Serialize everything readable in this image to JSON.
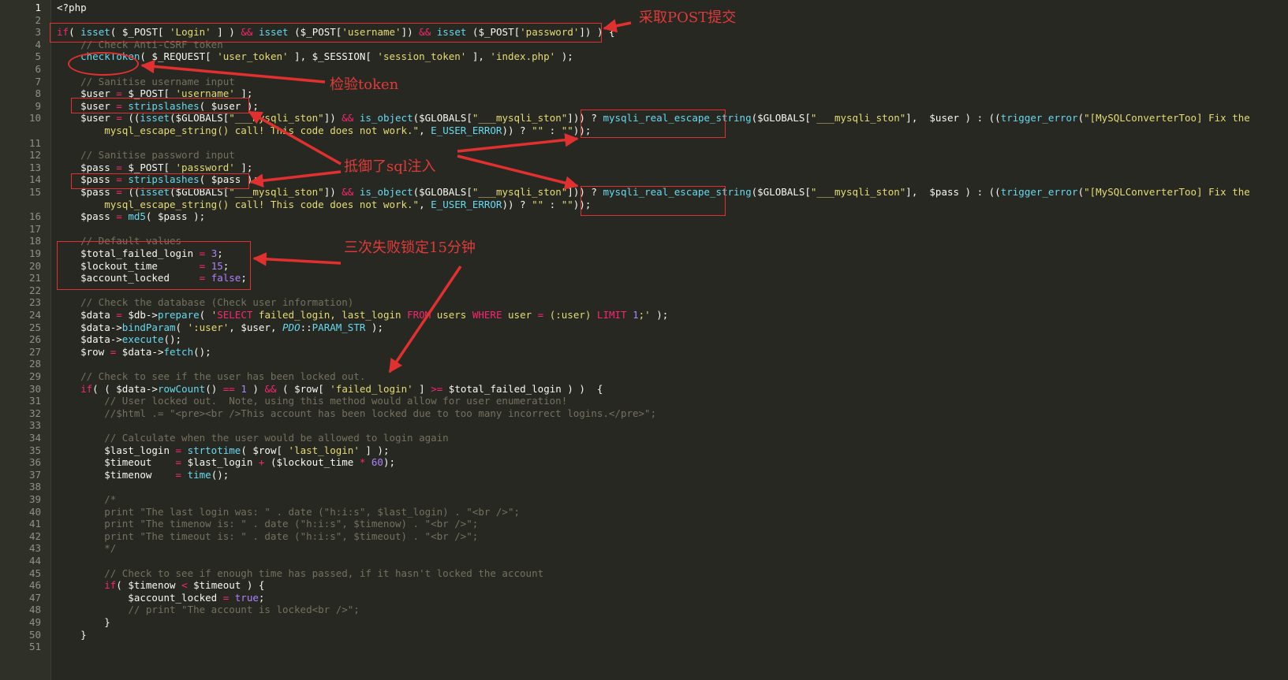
{
  "lines": [
    {
      "n": "1",
      "segs": [
        [
          "<?php",
          ""
        ]
      ]
    },
    {
      "n": "2",
      "segs": []
    },
    {
      "n": "3",
      "segs": [
        [
          "if",
          "k"
        ],
        [
          "( ",
          ""
        ],
        [
          "isset",
          "f"
        ],
        [
          "( $_POST[ ",
          ""
        ],
        [
          "'Login'",
          "s"
        ],
        [
          " ] ) ",
          ""
        ],
        [
          "&&",
          "k"
        ],
        [
          " ",
          ""
        ],
        [
          "isset",
          "f"
        ],
        [
          " ($_POST[",
          ""
        ],
        [
          "'username'",
          "s"
        ],
        [
          "]) ",
          ""
        ],
        [
          "&&",
          "k"
        ],
        [
          " ",
          ""
        ],
        [
          "isset",
          "f"
        ],
        [
          " ($_POST[",
          ""
        ],
        [
          "'password'",
          "s"
        ],
        [
          "]) ) {",
          ""
        ]
      ]
    },
    {
      "n": "4",
      "segs": [
        [
          "    ",
          ""
        ],
        [
          "// Check Anti-CSRF token",
          "c"
        ]
      ]
    },
    {
      "n": "5",
      "segs": [
        [
          "    ",
          ""
        ],
        [
          "checkToken",
          "f"
        ],
        [
          "( $_REQUEST[ ",
          ""
        ],
        [
          "'user_token'",
          "s"
        ],
        [
          " ], $_SESSION[ ",
          ""
        ],
        [
          "'session_token'",
          "s"
        ],
        [
          " ], ",
          ""
        ],
        [
          "'index.php'",
          "s"
        ],
        [
          " );",
          ""
        ]
      ]
    },
    {
      "n": "6",
      "segs": []
    },
    {
      "n": "7",
      "segs": [
        [
          "    ",
          ""
        ],
        [
          "// Sanitise username input",
          "c"
        ]
      ]
    },
    {
      "n": "8",
      "segs": [
        [
          "    $user ",
          ""
        ],
        [
          "=",
          "k"
        ],
        [
          " $_POST[ ",
          ""
        ],
        [
          "'username'",
          "s"
        ],
        [
          " ];",
          ""
        ]
      ]
    },
    {
      "n": "9",
      "segs": [
        [
          "    $user ",
          ""
        ],
        [
          "=",
          "k"
        ],
        [
          " ",
          ""
        ],
        [
          "stripslashes",
          "f"
        ],
        [
          "( $user );",
          ""
        ]
      ]
    },
    {
      "n": "10",
      "segs": [
        [
          "    $user ",
          ""
        ],
        [
          "=",
          "k"
        ],
        [
          " ((",
          ""
        ],
        [
          "isset",
          "f"
        ],
        [
          "($GLOBALS[",
          ""
        ],
        [
          "\"___mysqli_ston\"",
          "s"
        ],
        [
          "]) ",
          ""
        ],
        [
          "&&",
          "k"
        ],
        [
          " ",
          ""
        ],
        [
          "is_object",
          "f"
        ],
        [
          "($GLOBALS[",
          ""
        ],
        [
          "\"___mysqli_ston\"",
          "s"
        ],
        [
          "])) ? ",
          ""
        ],
        [
          "mysqli_real_escape_string",
          "f"
        ],
        [
          "($GLOBALS[",
          ""
        ],
        [
          "\"___mysqli_ston\"",
          "s"
        ],
        [
          "],  $user ) : ((",
          ""
        ],
        [
          "trigger_error",
          "f"
        ],
        [
          "(",
          ""
        ],
        [
          "\"[MySQLConverterToo] Fix the",
          "s"
        ]
      ]
    },
    {
      "n": "",
      "segs": [
        [
          "        ",
          ""
        ],
        [
          "mysql_escape_string() call! This code does not work.\"",
          "s"
        ],
        [
          ", ",
          ""
        ],
        [
          "E_USER_ERROR",
          "f"
        ],
        [
          ")) ? ",
          ""
        ],
        [
          "\"\"",
          "s"
        ],
        [
          " : ",
          ""
        ],
        [
          "\"\"",
          "s"
        ],
        [
          "));",
          ""
        ]
      ]
    },
    {
      "n": "11",
      "segs": []
    },
    {
      "n": "12",
      "segs": [
        [
          "    ",
          ""
        ],
        [
          "// Sanitise password input",
          "c"
        ]
      ]
    },
    {
      "n": "13",
      "segs": [
        [
          "    $pass ",
          ""
        ],
        [
          "=",
          "k"
        ],
        [
          " $_POST[ ",
          ""
        ],
        [
          "'password'",
          "s"
        ],
        [
          " ];",
          ""
        ]
      ]
    },
    {
      "n": "14",
      "segs": [
        [
          "    $pass ",
          ""
        ],
        [
          "=",
          "k"
        ],
        [
          " ",
          ""
        ],
        [
          "stripslashes",
          "f"
        ],
        [
          "( $pass );",
          ""
        ]
      ]
    },
    {
      "n": "15",
      "segs": [
        [
          "    $pass ",
          ""
        ],
        [
          "=",
          "k"
        ],
        [
          " ((",
          ""
        ],
        [
          "isset",
          "f"
        ],
        [
          "($GLOBALS[",
          ""
        ],
        [
          "\"___mysqli_ston\"",
          "s"
        ],
        [
          "]) ",
          ""
        ],
        [
          "&&",
          "k"
        ],
        [
          " ",
          ""
        ],
        [
          "is_object",
          "f"
        ],
        [
          "($GLOBALS[",
          ""
        ],
        [
          "\"___mysqli_ston\"",
          "s"
        ],
        [
          "])) ? ",
          ""
        ],
        [
          "mysqli_real_escape_string",
          "f"
        ],
        [
          "($GLOBALS[",
          ""
        ],
        [
          "\"___mysqli_ston\"",
          "s"
        ],
        [
          "],  $pass ) : ((",
          ""
        ],
        [
          "trigger_error",
          "f"
        ],
        [
          "(",
          ""
        ],
        [
          "\"[MySQLConverterToo] Fix the",
          "s"
        ]
      ]
    },
    {
      "n": "",
      "segs": [
        [
          "        ",
          ""
        ],
        [
          "mysql_escape_string() call! This code does not work.\"",
          "s"
        ],
        [
          ", ",
          ""
        ],
        [
          "E_USER_ERROR",
          "f"
        ],
        [
          ")) ? ",
          ""
        ],
        [
          "\"\"",
          "s"
        ],
        [
          " : ",
          ""
        ],
        [
          "\"\"",
          "s"
        ],
        [
          "));",
          ""
        ]
      ]
    },
    {
      "n": "16",
      "segs": [
        [
          "    $pass ",
          ""
        ],
        [
          "=",
          "k"
        ],
        [
          " ",
          ""
        ],
        [
          "md5",
          "f"
        ],
        [
          "( $pass );",
          ""
        ]
      ]
    },
    {
      "n": "17",
      "segs": []
    },
    {
      "n": "18",
      "segs": [
        [
          "    ",
          ""
        ],
        [
          "// Default values",
          "c"
        ]
      ]
    },
    {
      "n": "19",
      "segs": [
        [
          "    $total_failed_login ",
          ""
        ],
        [
          "=",
          "k"
        ],
        [
          " ",
          ""
        ],
        [
          "3",
          "n"
        ],
        [
          ";",
          ""
        ]
      ]
    },
    {
      "n": "20",
      "segs": [
        [
          "    $lockout_time       ",
          ""
        ],
        [
          "=",
          "k"
        ],
        [
          " ",
          ""
        ],
        [
          "15",
          "n"
        ],
        [
          ";",
          ""
        ]
      ]
    },
    {
      "n": "21",
      "segs": [
        [
          "    $account_locked     ",
          ""
        ],
        [
          "=",
          "k"
        ],
        [
          " ",
          ""
        ],
        [
          "false",
          "n"
        ],
        [
          ";",
          ""
        ]
      ]
    },
    {
      "n": "22",
      "segs": []
    },
    {
      "n": "23",
      "segs": [
        [
          "    ",
          ""
        ],
        [
          "// Check the database (Check user information)",
          "c"
        ]
      ]
    },
    {
      "n": "24",
      "segs": [
        [
          "    $data ",
          ""
        ],
        [
          "=",
          "k"
        ],
        [
          " $db->",
          ""
        ],
        [
          "prepare",
          "f"
        ],
        [
          "( ",
          ""
        ],
        [
          "'",
          "s"
        ],
        [
          "SELECT",
          "k"
        ],
        [
          " failed_login, last_login ",
          "s"
        ],
        [
          "FROM",
          "k"
        ],
        [
          " users ",
          "s"
        ],
        [
          "WHERE",
          "k"
        ],
        [
          " user ",
          "s"
        ],
        [
          "=",
          "k"
        ],
        [
          " (:user) ",
          "s"
        ],
        [
          "LIMIT",
          "k"
        ],
        [
          " ",
          "s"
        ],
        [
          "1",
          "n"
        ],
        [
          ";'",
          "s"
        ],
        [
          " );",
          ""
        ]
      ]
    },
    {
      "n": "25",
      "segs": [
        [
          "    $data->",
          ""
        ],
        [
          "bindParam",
          "f"
        ],
        [
          "( ",
          ""
        ],
        [
          "':user'",
          "s"
        ],
        [
          ", $user, ",
          ""
        ],
        [
          "PDO",
          "i"
        ],
        [
          "::",
          ""
        ],
        [
          "PARAM_STR",
          "f"
        ],
        [
          " );",
          ""
        ]
      ]
    },
    {
      "n": "26",
      "segs": [
        [
          "    $data->",
          ""
        ],
        [
          "execute",
          "f"
        ],
        [
          "();",
          ""
        ]
      ]
    },
    {
      "n": "27",
      "segs": [
        [
          "    $row ",
          ""
        ],
        [
          "=",
          "k"
        ],
        [
          " $data->",
          ""
        ],
        [
          "fetch",
          "f"
        ],
        [
          "();",
          ""
        ]
      ]
    },
    {
      "n": "28",
      "segs": []
    },
    {
      "n": "29",
      "segs": [
        [
          "    ",
          ""
        ],
        [
          "// Check to see if the user has been locked out.",
          "c"
        ]
      ]
    },
    {
      "n": "30",
      "segs": [
        [
          "    ",
          ""
        ],
        [
          "if",
          "k"
        ],
        [
          "( ( $data->",
          ""
        ],
        [
          "rowCount",
          "f"
        ],
        [
          "() ",
          ""
        ],
        [
          "==",
          "k"
        ],
        [
          " ",
          ""
        ],
        [
          "1",
          "n"
        ],
        [
          " ) ",
          ""
        ],
        [
          "&&",
          "k"
        ],
        [
          " ( $row[ ",
          ""
        ],
        [
          "'failed_login'",
          "s"
        ],
        [
          " ] ",
          ""
        ],
        [
          ">=",
          "k"
        ],
        [
          " $total_failed_login ) )  {",
          ""
        ]
      ]
    },
    {
      "n": "31",
      "segs": [
        [
          "        ",
          ""
        ],
        [
          "// User locked out.  Note, using this method would allow for user enumeration!",
          "c"
        ]
      ]
    },
    {
      "n": "32",
      "segs": [
        [
          "        ",
          ""
        ],
        [
          "//$html .= \"<pre><br />This account has been locked due to too many incorrect logins.</pre>\";",
          "c"
        ]
      ]
    },
    {
      "n": "33",
      "segs": []
    },
    {
      "n": "34",
      "segs": [
        [
          "        ",
          ""
        ],
        [
          "// Calculate when the user would be allowed to login again",
          "c"
        ]
      ]
    },
    {
      "n": "35",
      "segs": [
        [
          "        $last_login ",
          ""
        ],
        [
          "=",
          "k"
        ],
        [
          " ",
          ""
        ],
        [
          "strtotime",
          "f"
        ],
        [
          "( $row[ ",
          ""
        ],
        [
          "'last_login'",
          "s"
        ],
        [
          " ] );",
          ""
        ]
      ]
    },
    {
      "n": "36",
      "segs": [
        [
          "        $timeout    ",
          ""
        ],
        [
          "=",
          "k"
        ],
        [
          " $last_login ",
          ""
        ],
        [
          "+",
          "k"
        ],
        [
          " ($lockout_time ",
          ""
        ],
        [
          "*",
          "k"
        ],
        [
          " ",
          ""
        ],
        [
          "60",
          "n"
        ],
        [
          ");",
          ""
        ]
      ]
    },
    {
      "n": "37",
      "segs": [
        [
          "        $timenow    ",
          ""
        ],
        [
          "=",
          "k"
        ],
        [
          " ",
          ""
        ],
        [
          "time",
          "f"
        ],
        [
          "();",
          ""
        ]
      ]
    },
    {
      "n": "38",
      "segs": []
    },
    {
      "n": "39",
      "segs": [
        [
          "        ",
          ""
        ],
        [
          "/*",
          "c"
        ]
      ]
    },
    {
      "n": "40",
      "segs": [
        [
          "        ",
          ""
        ],
        [
          "print \"The last login was: \" . date (\"h:i:s\", $last_login) . \"<br />\";",
          "c"
        ]
      ]
    },
    {
      "n": "41",
      "segs": [
        [
          "        ",
          ""
        ],
        [
          "print \"The timenow is: \" . date (\"h:i:s\", $timenow) . \"<br />\";",
          "c"
        ]
      ]
    },
    {
      "n": "42",
      "segs": [
        [
          "        ",
          ""
        ],
        [
          "print \"The timeout is: \" . date (\"h:i:s\", $timeout) . \"<br />\";",
          "c"
        ]
      ]
    },
    {
      "n": "43",
      "segs": [
        [
          "        ",
          ""
        ],
        [
          "*/",
          "c"
        ]
      ]
    },
    {
      "n": "44",
      "segs": []
    },
    {
      "n": "45",
      "segs": [
        [
          "        ",
          ""
        ],
        [
          "// Check to see if enough time has passed, if it hasn't locked the account",
          "c"
        ]
      ]
    },
    {
      "n": "46",
      "segs": [
        [
          "        ",
          ""
        ],
        [
          "if",
          "k"
        ],
        [
          "( $timenow ",
          ""
        ],
        [
          "<",
          "k"
        ],
        [
          " $timeout ) {",
          ""
        ]
      ]
    },
    {
      "n": "47",
      "segs": [
        [
          "            $account_locked ",
          ""
        ],
        [
          "=",
          "k"
        ],
        [
          " ",
          ""
        ],
        [
          "true",
          "n"
        ],
        [
          ";",
          ""
        ]
      ]
    },
    {
      "n": "48",
      "segs": [
        [
          "            ",
          ""
        ],
        [
          "// print \"The account is locked<br />\";",
          "c"
        ]
      ]
    },
    {
      "n": "49",
      "segs": [
        [
          "        }",
          ""
        ]
      ]
    },
    {
      "n": "50",
      "segs": [
        [
          "    }",
          ""
        ]
      ]
    },
    {
      "n": "51",
      "segs": []
    }
  ],
  "annotations": {
    "post": "采取POST提交",
    "token": "检验token",
    "sqli": "抵御了sql注入",
    "lock": "三次失败锁定15分钟"
  },
  "colors": {
    "background": "#272822",
    "annotation": "#e03030"
  }
}
